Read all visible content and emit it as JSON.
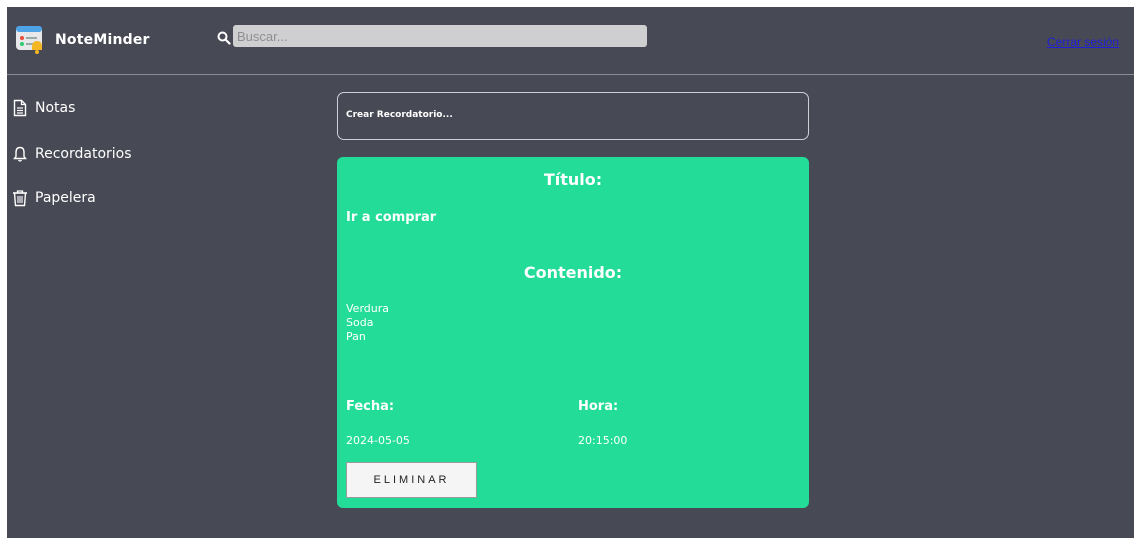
{
  "header": {
    "app_name": "NoteMinder",
    "logo_icon": "reminder-app-logo-icon",
    "search": {
      "placeholder": "Buscar...",
      "value": "",
      "icon": "search-icon"
    },
    "logout_label": "Cerrar sesión"
  },
  "sidebar": {
    "items": [
      {
        "label": "Notas",
        "icon": "document-icon"
      },
      {
        "label": "Recordatorios",
        "icon": "bell-icon"
      },
      {
        "label": "Papelera",
        "icon": "trash-icon"
      }
    ]
  },
  "create_reminder": {
    "label": "Crear Recordatorio..."
  },
  "reminder_card": {
    "title_heading": "Título:",
    "title_value": "Ir a comprar",
    "content_heading": "Contenido:",
    "content_lines": [
      "Verdura",
      "Soda",
      "Pan"
    ],
    "date_label": "Fecha:",
    "date_value": "2024-05-05",
    "time_label": "Hora:",
    "time_value": "20:15:00",
    "delete_label": "ELIMINAR"
  },
  "colors": {
    "background": "#474954",
    "card": "#22dc98",
    "link": "#1f1fd8",
    "text": "#ffffff"
  }
}
